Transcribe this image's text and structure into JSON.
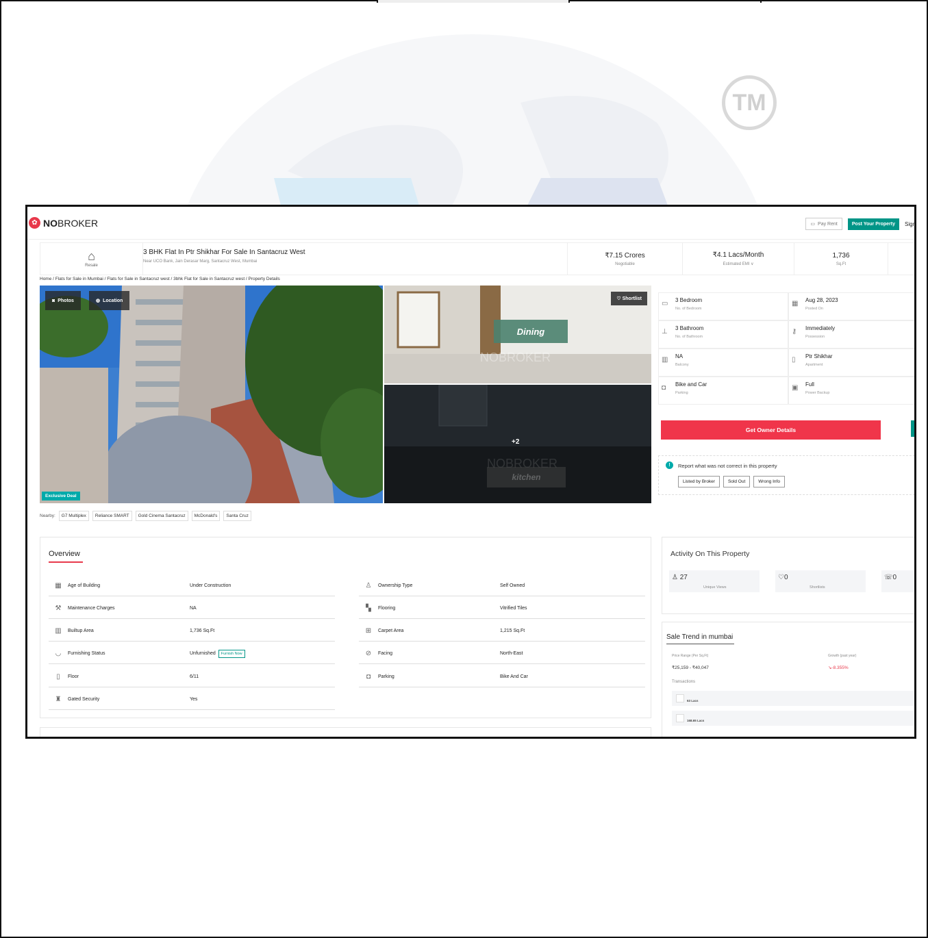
{
  "nav": {
    "brand_bold": "NO",
    "brand_rest": "BROKER",
    "pay_rent": "Pay Rent",
    "post_property": "Post Your Property",
    "sign_in": "Sign"
  },
  "title_bar": {
    "type_label": "Resale",
    "title": "3 BHK Flat In Ptr Shikhar For Sale In Santacruz West",
    "address": "Near UCO Bank, Jain Derasar Marg, Santacruz West, Mumbai",
    "price": "₹7.15 Crores",
    "price_label": "Negotiable",
    "emi": "₹4.1 Lacs/Month",
    "emi_label": "Estimated EMI ∨",
    "area": "1,736",
    "area_label": "Sq.Ft"
  },
  "breadcrumb": "Home / Flats for Sale in Mumbai / Flats for Sale in Santacruz west / 3bhk Flat for Sale in Santacruz west / Property Details",
  "gallery": {
    "photos_label": "Photos",
    "location_label": "Location",
    "exclusive_label": "Exclusive Deal",
    "dining_label": "Dining",
    "watermark": "NOBROKER",
    "shortlist_label": "Shortlist",
    "more_count": "+2",
    "kitchen_label": "kitchen"
  },
  "specs": [
    {
      "value": "3 Bedroom",
      "label": "No. of Bedroom",
      "icon": "bed-icon"
    },
    {
      "value": "Aug 28, 2023",
      "label": "Posted On",
      "icon": "calendar-icon"
    },
    {
      "value": "3 Bathroom",
      "label": "No. of Bathroom",
      "icon": "bath-icon"
    },
    {
      "value": "Immediately",
      "label": "Possession",
      "icon": "key-icon"
    },
    {
      "value": "NA",
      "label": "Balcony",
      "icon": "balcony-icon"
    },
    {
      "value": "Ptr Shikhar",
      "label": "Apartment",
      "icon": "building-icon"
    },
    {
      "value": "Bike and Car",
      "label": "Parking",
      "icon": "car-icon"
    },
    {
      "value": "Full",
      "label": "Power Backup",
      "icon": "battery-icon"
    }
  ],
  "owner_button": "Get Owner Details",
  "report": {
    "text": "Report what was not correct in this property",
    "chips": [
      "Listed by Broker",
      "Sold Out",
      "Wrong Info"
    ]
  },
  "nearby": {
    "label": "Nearby:",
    "items": [
      "G7 Multiplex",
      "Reliance SMART",
      "Gold Cinema Santacruz",
      "McDonald's",
      "Santa Cruz"
    ]
  },
  "overview": {
    "title": "Overview",
    "left": [
      {
        "key": "Age of Building",
        "value": "Under Construction",
        "icon": "calendar-icon"
      },
      {
        "key": "Maintenance Charges",
        "value": "NA",
        "icon": "tools-icon"
      },
      {
        "key": "Builtup Area",
        "value": "1,736 Sq.Ft",
        "icon": "building-icon"
      },
      {
        "key": "Furnishing Status",
        "value": "Unfurnished",
        "icon": "sofa-icon"
      },
      {
        "key": "Floor",
        "value": "6/11",
        "icon": "floor-icon"
      },
      {
        "key": "Gated Security",
        "value": "Yes",
        "icon": "guard-icon"
      }
    ],
    "right": [
      {
        "key": "Ownership Type",
        "value": "Self Owned",
        "icon": "owner-icon"
      },
      {
        "key": "Flooring",
        "value": "Vitrified Tiles",
        "icon": "tiles-icon"
      },
      {
        "key": "Carpet Area",
        "value": "1,215 Sq.Ft",
        "icon": "area-icon"
      },
      {
        "key": "Facing",
        "value": "North-East",
        "icon": "compass-icon"
      },
      {
        "key": "Parking",
        "value": "Bike And Car",
        "icon": "car-icon"
      }
    ],
    "furnish_now": "Furnish Now"
  },
  "activity": {
    "title": "Activity On This Property",
    "unique_views": "27",
    "unique_views_label": "Unique Views",
    "shortlists": "0",
    "shortlists_label": "Shortlists",
    "contacted": "0"
  },
  "sale_trend": {
    "title": "Sale Trend in mumbai",
    "price_range_label": "Price Range (Per Sq.Ft)",
    "price_range": "₹25,159 - ₹40,047",
    "growth_label": "Growth (past year)",
    "growth": "↘-8.355%",
    "transactions_label": "Transactions",
    "rows": [
      "63 Lacs",
      "168.65 Lacs"
    ]
  },
  "colors": {
    "brand_red": "#e8394b",
    "accent_teal": "#009587",
    "cta_red": "#f0354a"
  }
}
